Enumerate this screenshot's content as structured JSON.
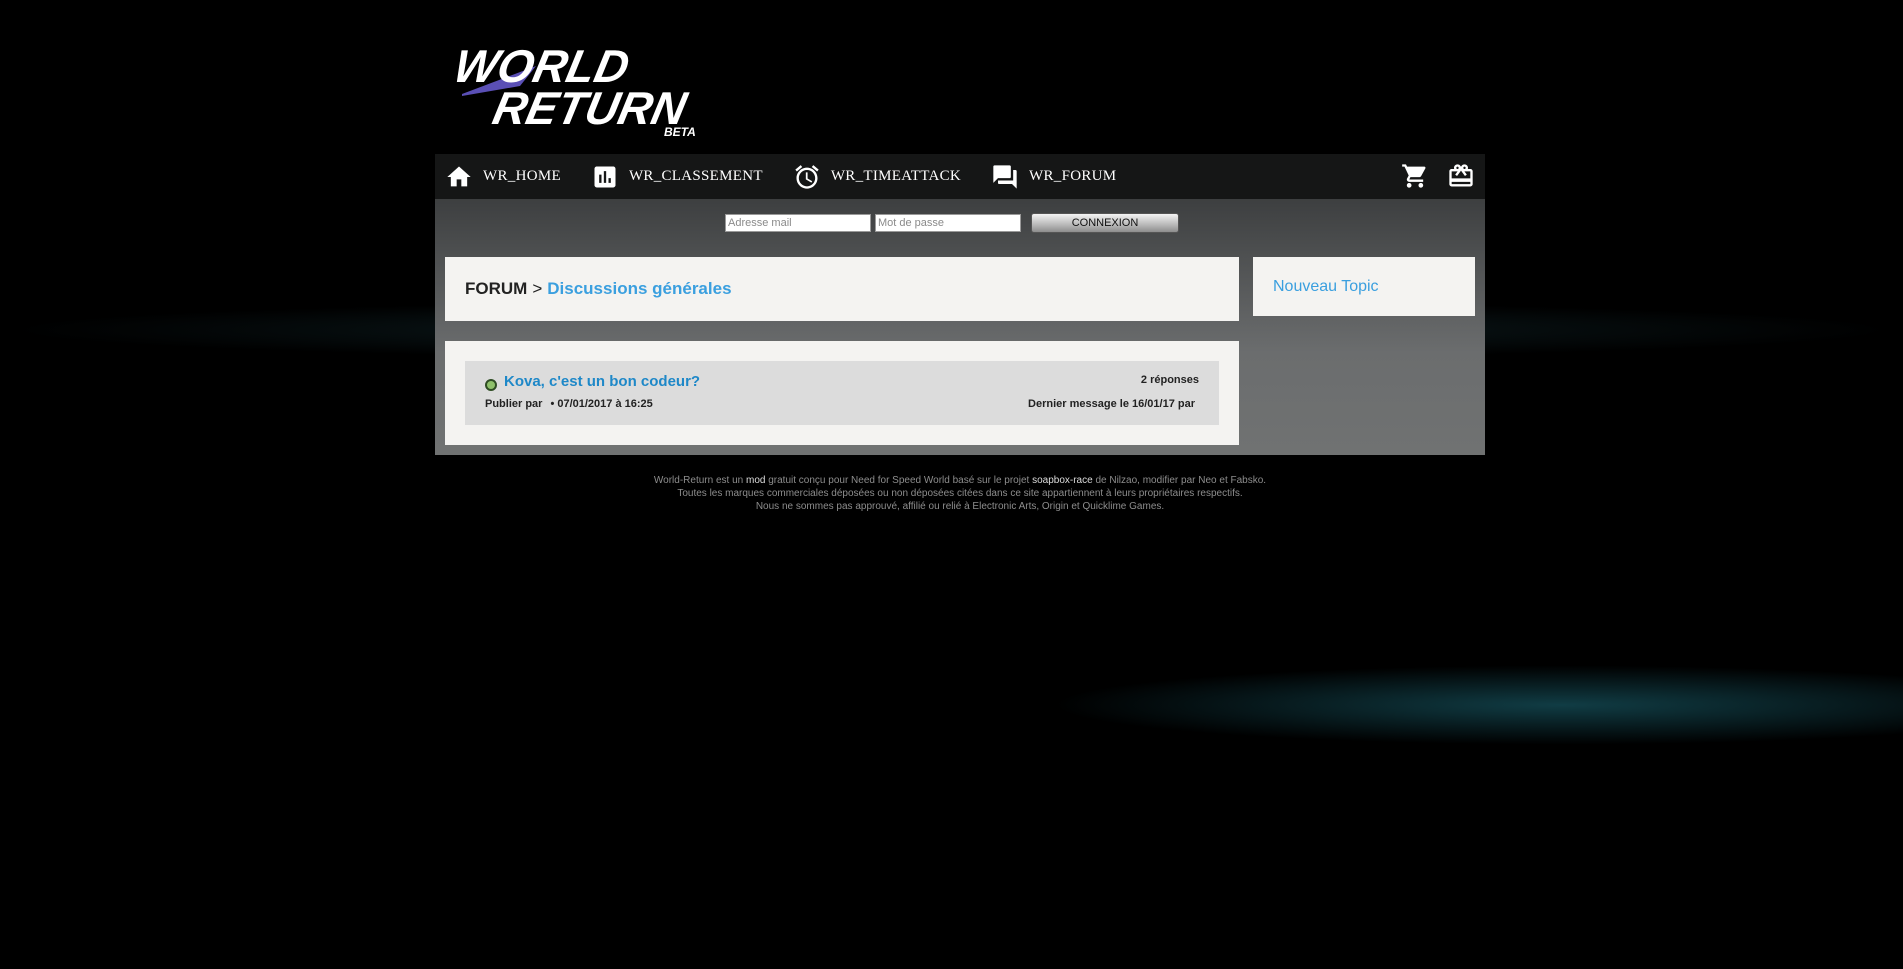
{
  "colors": {
    "accent": "#3a9fdf",
    "background": "#000000",
    "panel": "#f4f3f1"
  },
  "header": {
    "logo_primary": "WORLD",
    "logo_secondary": "RETURN",
    "logo_badge": "BETA"
  },
  "nav": {
    "items": [
      {
        "label": "WR_HOME",
        "icon": "home-icon"
      },
      {
        "label": "WR_CLASSEMENT",
        "icon": "leaderboard-icon"
      },
      {
        "label": "WR_TIMEATTACK",
        "icon": "alarm-clock-icon"
      },
      {
        "label": "WR_FORUM",
        "icon": "forum-icon"
      }
    ],
    "right_icons": [
      "cart-icon",
      "gift-card-icon"
    ]
  },
  "login": {
    "email_placeholder": "Adresse mail",
    "password_placeholder": "Mot de passe",
    "submit_label": "CONNEXION"
  },
  "breadcrumb": {
    "root": "FORUM",
    "separator": ">",
    "current": "Discussions générales"
  },
  "sidebar": {
    "new_topic_label": "Nouveau Topic"
  },
  "topics": [
    {
      "title": "Kova, c'est un bon codeur?",
      "author_prefix": "Publier par",
      "date": "07/01/2017 à 16:25",
      "replies": "2 réponses",
      "last_message": "Dernier message le 16/01/17 par"
    }
  ],
  "footer": {
    "line1_a": "World-Return est un",
    "line1_mod": "mod",
    "line1_b": "gratuit conçu pour Need for Speed World basé sur le projet",
    "line1_project": "soapbox-race",
    "line1_c": "de Nilzao, modifier par Neo et Fabsko.",
    "line2": "Toutes les marques commerciales déposées ou non déposées citées dans ce site appartiennent à leurs propriétaires respectifs.",
    "line3": "Nous ne sommes pas approuvé, affilié ou relié à Electronic Arts, Origin et Quicklime Games."
  }
}
